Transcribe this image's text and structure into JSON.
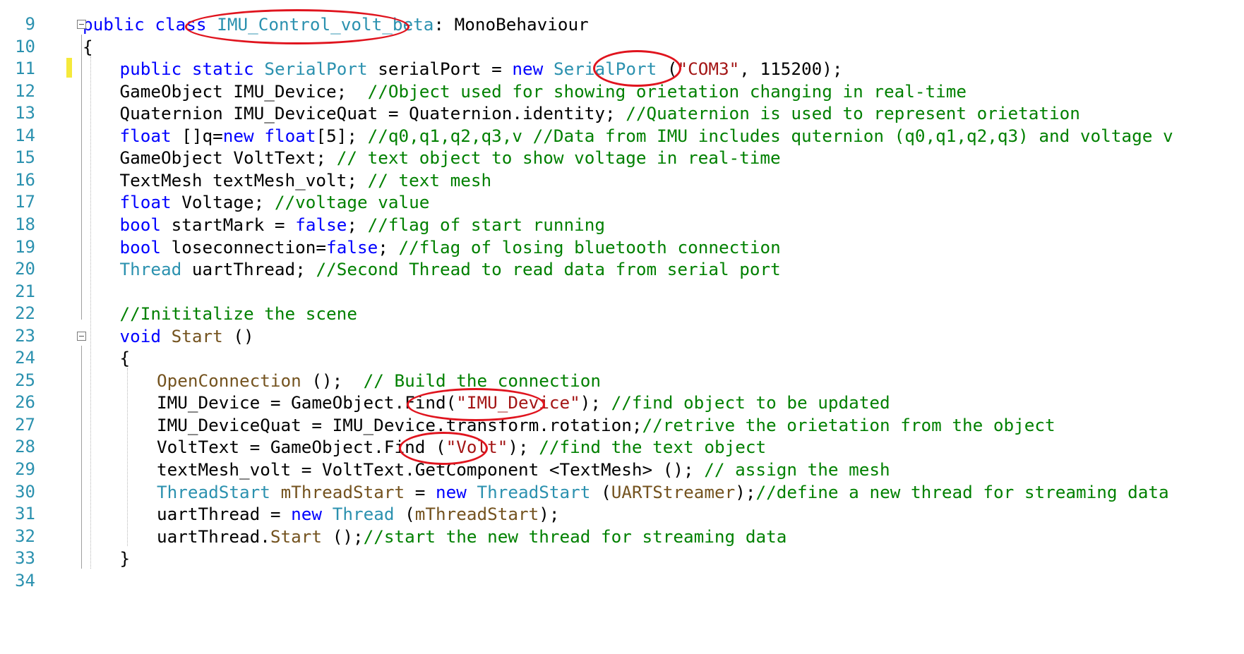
{
  "colors": {
    "keyword": "#0000ff",
    "type": "#2b91af",
    "comment": "#008000",
    "string": "#a31515",
    "method": "#74531f",
    "plain": "#000000",
    "line_number": "#2b91af",
    "annotation": "#e0141e"
  },
  "lines": [
    {
      "n": "9",
      "indent": 0,
      "segs": [
        [
          "keyword",
          "public"
        ],
        [
          "plain",
          " "
        ],
        [
          "keyword",
          "class"
        ],
        [
          "plain",
          " "
        ],
        [
          "type",
          "IMU_Control_volt_beta"
        ],
        [
          "plain",
          ": MonoBehaviour"
        ]
      ]
    },
    {
      "n": "10",
      "indent": 0,
      "segs": [
        [
          "plain",
          "{"
        ]
      ]
    },
    {
      "n": "11",
      "indent": 1,
      "segs": [
        [
          "keyword",
          "public"
        ],
        [
          "plain",
          " "
        ],
        [
          "keyword",
          "static"
        ],
        [
          "plain",
          " "
        ],
        [
          "type",
          "SerialPort"
        ],
        [
          "plain",
          " serialPort = "
        ],
        [
          "keyword",
          "new"
        ],
        [
          "plain",
          " "
        ],
        [
          "type",
          "SerialPort"
        ],
        [
          "plain",
          " ("
        ],
        [
          "string",
          "\"COM3\""
        ],
        [
          "plain",
          ", 115200);"
        ]
      ]
    },
    {
      "n": "12",
      "indent": 1,
      "segs": [
        [
          "plain",
          "GameObject IMU_Device;  "
        ],
        [
          "comment",
          "//Object used for showing orietation changing in real-time"
        ]
      ]
    },
    {
      "n": "13",
      "indent": 1,
      "segs": [
        [
          "plain",
          "Quaternion IMU_DeviceQuat = Quaternion.identity; "
        ],
        [
          "comment",
          "//Quaternion is used to represent orietation"
        ]
      ]
    },
    {
      "n": "14",
      "indent": 1,
      "segs": [
        [
          "keyword",
          "float"
        ],
        [
          "plain",
          " []q="
        ],
        [
          "keyword",
          "new"
        ],
        [
          "plain",
          " "
        ],
        [
          "keyword",
          "float"
        ],
        [
          "plain",
          "[5]; "
        ],
        [
          "comment",
          "//q0,q1,q2,q3,v //Data from IMU includes quternion (q0,q1,q2,q3) and voltage v"
        ]
      ]
    },
    {
      "n": "15",
      "indent": 1,
      "segs": [
        [
          "plain",
          "GameObject VoltText; "
        ],
        [
          "comment",
          "// text object to show voltage in real-time"
        ]
      ]
    },
    {
      "n": "16",
      "indent": 1,
      "segs": [
        [
          "plain",
          "TextMesh textMesh_volt; "
        ],
        [
          "comment",
          "// text mesh"
        ]
      ]
    },
    {
      "n": "17",
      "indent": 1,
      "segs": [
        [
          "keyword",
          "float"
        ],
        [
          "plain",
          " Voltage; "
        ],
        [
          "comment",
          "//voltage value"
        ]
      ]
    },
    {
      "n": "18",
      "indent": 1,
      "segs": [
        [
          "keyword",
          "bool"
        ],
        [
          "plain",
          " startMark = "
        ],
        [
          "keyword",
          "false"
        ],
        [
          "plain",
          "; "
        ],
        [
          "comment",
          "//flag of start running"
        ]
      ]
    },
    {
      "n": "19",
      "indent": 1,
      "segs": [
        [
          "keyword",
          "bool"
        ],
        [
          "plain",
          " loseconnection="
        ],
        [
          "keyword",
          "false"
        ],
        [
          "plain",
          "; "
        ],
        [
          "comment",
          "//flag of losing bluetooth connection"
        ]
      ]
    },
    {
      "n": "20",
      "indent": 1,
      "segs": [
        [
          "type",
          "Thread"
        ],
        [
          "plain",
          " uartThread; "
        ],
        [
          "comment",
          "//Second Thread to read data from serial port"
        ]
      ]
    },
    {
      "n": "21",
      "indent": 1,
      "segs": []
    },
    {
      "n": "22",
      "indent": 1,
      "segs": [
        [
          "comment",
          "//Inititalize the scene"
        ]
      ]
    },
    {
      "n": "23",
      "indent": 1,
      "segs": [
        [
          "keyword",
          "void"
        ],
        [
          "plain",
          " "
        ],
        [
          "method",
          "Start"
        ],
        [
          "plain",
          " ()"
        ]
      ]
    },
    {
      "n": "24",
      "indent": 1,
      "segs": [
        [
          "plain",
          "{"
        ]
      ]
    },
    {
      "n": "25",
      "indent": 2,
      "segs": [
        [
          "method",
          "OpenConnection"
        ],
        [
          "plain",
          " ();  "
        ],
        [
          "comment",
          "// Build the connection"
        ]
      ]
    },
    {
      "n": "26",
      "indent": 2,
      "segs": [
        [
          "plain",
          "IMU_Device = GameObject.Find("
        ],
        [
          "string",
          "\"IMU_Device\""
        ],
        [
          "plain",
          "); "
        ],
        [
          "comment",
          "//find object to be updated"
        ]
      ]
    },
    {
      "n": "27",
      "indent": 2,
      "segs": [
        [
          "plain",
          "IMU_DeviceQuat = IMU_Device.transform.rotation;"
        ],
        [
          "comment",
          "//retrive the orietation from the object"
        ]
      ]
    },
    {
      "n": "28",
      "indent": 2,
      "segs": [
        [
          "plain",
          "VoltText = GameObject.Find ("
        ],
        [
          "string",
          "\"Volt\""
        ],
        [
          "plain",
          "); "
        ],
        [
          "comment",
          "//find the text object"
        ]
      ]
    },
    {
      "n": "29",
      "indent": 2,
      "segs": [
        [
          "plain",
          "textMesh_volt = VoltText.GetComponent <TextMesh> (); "
        ],
        [
          "comment",
          "// assign the mesh"
        ]
      ]
    },
    {
      "n": "30",
      "indent": 2,
      "segs": [
        [
          "type",
          "ThreadStart"
        ],
        [
          "plain",
          " "
        ],
        [
          "method",
          "mThreadStart"
        ],
        [
          "plain",
          " = "
        ],
        [
          "keyword",
          "new"
        ],
        [
          "plain",
          " "
        ],
        [
          "type",
          "ThreadStart"
        ],
        [
          "plain",
          " ("
        ],
        [
          "method",
          "UARTStreamer"
        ],
        [
          "plain",
          ");"
        ],
        [
          "comment",
          "//define a new thread for streaming data"
        ]
      ]
    },
    {
      "n": "31",
      "indent": 2,
      "segs": [
        [
          "plain",
          "uartThread = "
        ],
        [
          "keyword",
          "new"
        ],
        [
          "plain",
          " "
        ],
        [
          "type",
          "Thread"
        ],
        [
          "plain",
          " ("
        ],
        [
          "method",
          "mThreadStart"
        ],
        [
          "plain",
          ");"
        ]
      ]
    },
    {
      "n": "32",
      "indent": 2,
      "segs": [
        [
          "plain",
          "uartThread."
        ],
        [
          "method",
          "Start"
        ],
        [
          "plain",
          " ();"
        ],
        [
          "comment",
          "//start the new thread for streaming data"
        ]
      ]
    },
    {
      "n": "33",
      "indent": 1,
      "segs": [
        [
          "plain",
          "}"
        ]
      ]
    },
    {
      "n": "34",
      "indent": 1,
      "segs": []
    }
  ],
  "annotations": [
    {
      "name": "class-name-circle",
      "target": "IMU_Control_volt_beta"
    },
    {
      "name": "com-port-circle",
      "target": "\"COM3\""
    },
    {
      "name": "imu-device-circle",
      "target": "\"IMU_Device\""
    },
    {
      "name": "volt-circle",
      "target": "\"Volt\""
    }
  ]
}
